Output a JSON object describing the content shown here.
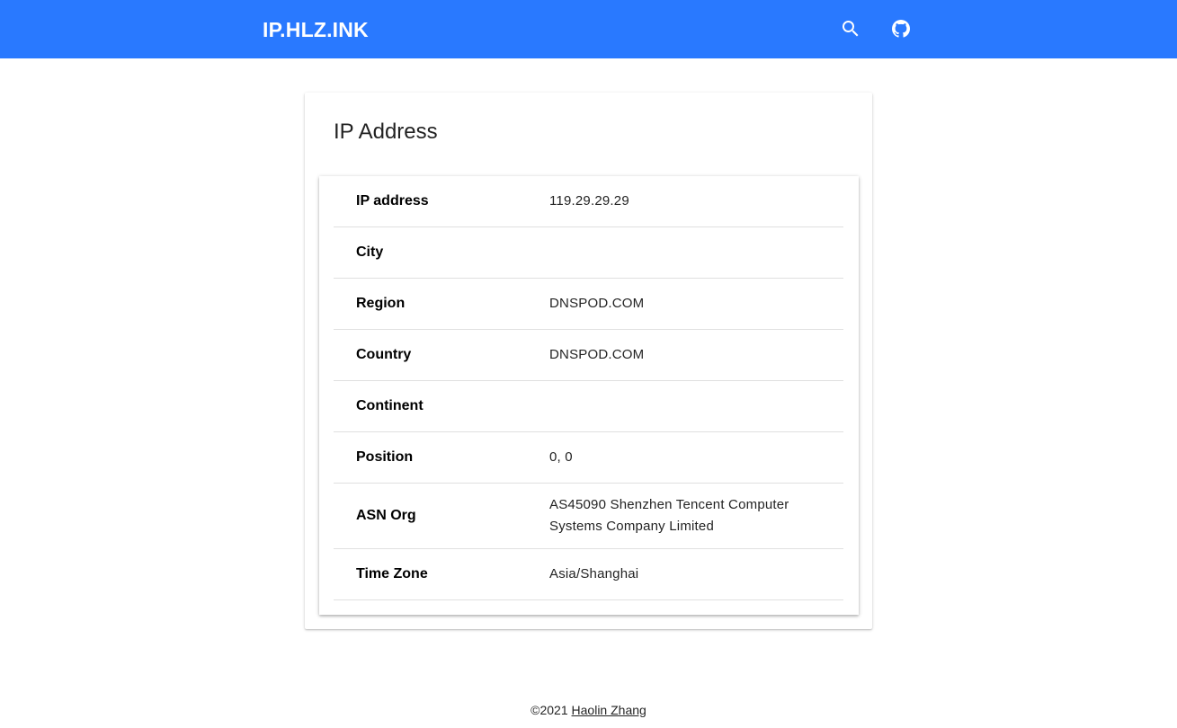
{
  "header": {
    "brand": "IP.HLZ.INK",
    "background_color": "#2979ff",
    "icons": [
      "search-icon",
      "github-icon"
    ]
  },
  "card": {
    "title": "IP Address",
    "rows": [
      {
        "key": "IP address",
        "value": "119.29.29.29"
      },
      {
        "key": "City",
        "value": ""
      },
      {
        "key": "Region",
        "value": "DNSPOD.COM"
      },
      {
        "key": "Country",
        "value": "DNSPOD.COM"
      },
      {
        "key": "Continent",
        "value": ""
      },
      {
        "key": "Position",
        "value": "0, 0"
      },
      {
        "key": "ASN Org",
        "value": "AS45090 Shenzhen Tencent Computer Systems Company Limited"
      },
      {
        "key": "Time Zone",
        "value": "Asia/Shanghai"
      }
    ]
  },
  "footer": {
    "copyright": "©2021",
    "author_link": "Haolin Zhang"
  }
}
